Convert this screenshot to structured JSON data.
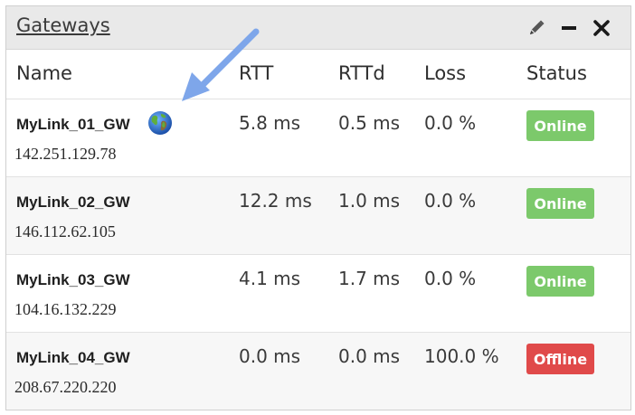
{
  "widget": {
    "title": "Gateways",
    "icons": [
      "pencil-icon",
      "minimize-icon",
      "close-icon"
    ]
  },
  "columns": {
    "name": "Name",
    "rtt": "RTT",
    "rttd": "RTTd",
    "loss": "Loss",
    "status": "Status"
  },
  "gateways": [
    {
      "name": "MyLink_01_GW",
      "ip": "142.251.129.78",
      "rtt": "5.8 ms",
      "rttd": "0.5 ms",
      "loss": "0.0 %",
      "status": "Online",
      "status_color": "#7cc96b",
      "has_globe": true
    },
    {
      "name": "MyLink_02_GW",
      "ip": "146.112.62.105",
      "rtt": "12.2 ms",
      "rttd": "1.0 ms",
      "loss": "0.0 %",
      "status": "Online",
      "status_color": "#7cc96b"
    },
    {
      "name": "MyLink_03_GW",
      "ip": "104.16.132.229",
      "rtt": "4.1 ms",
      "rttd": "1.7 ms",
      "loss": "0.0 %",
      "status": "Online",
      "status_color": "#7cc96b"
    },
    {
      "name": "MyLink_04_GW",
      "ip": "208.67.220.220",
      "rtt": "0.0 ms",
      "rttd": "0.0 ms",
      "loss": "100.0 %",
      "status": "Offline",
      "status_color": "#e04a4a"
    }
  ],
  "colors": {
    "online": "#7cc96b",
    "offline": "#e04a4a",
    "annotation_arrow": "#7ea6ea",
    "header_bg": "#e9e9e9"
  },
  "annotation": {
    "icon": "arrow-pointing-to-globe-icon"
  }
}
